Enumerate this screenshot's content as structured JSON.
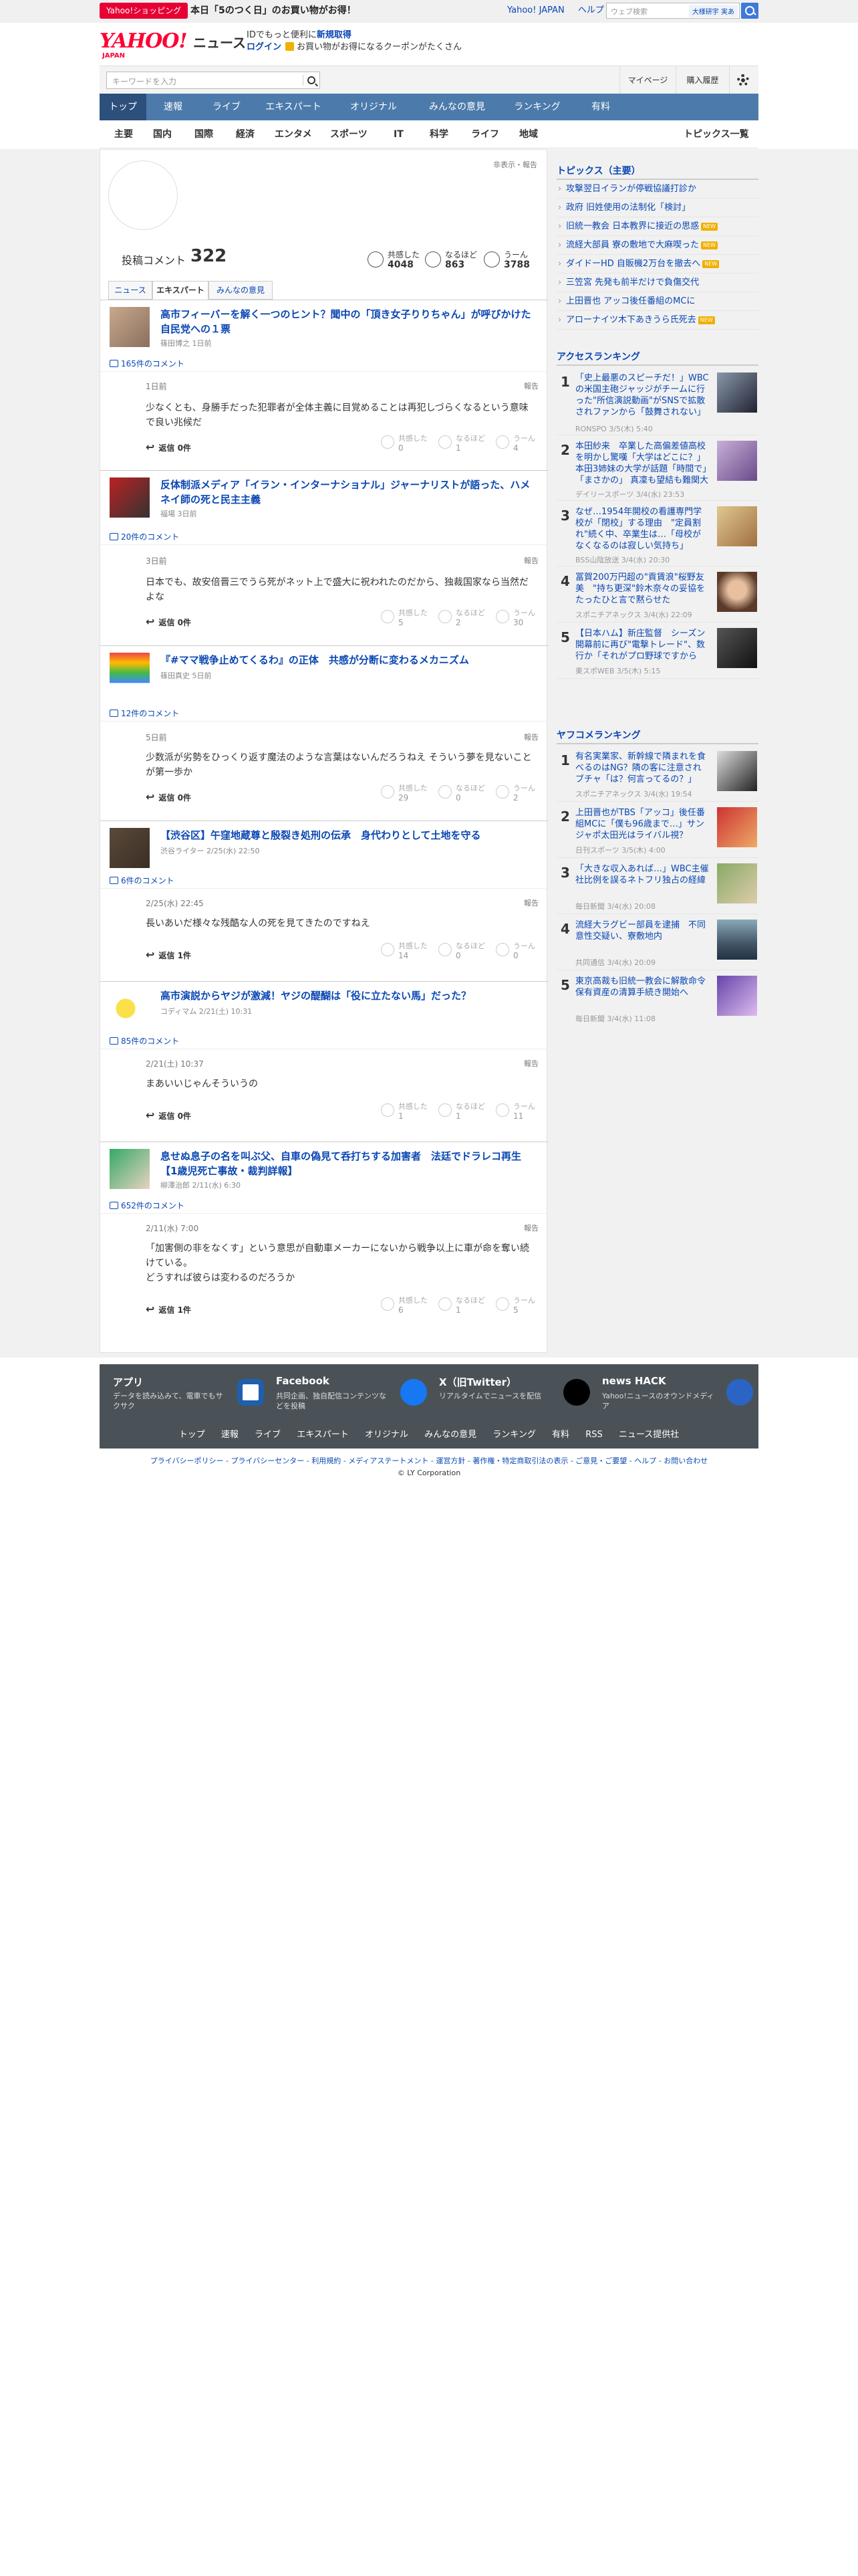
{
  "promo": {
    "badge": "Yahoo!ショッピング",
    "text": "本日「5のつく日」のお買い物がお得！",
    "link_yahoo": "Yahoo! JAPAN",
    "link_help": "ヘルプ",
    "search_placeholder": "ウェブ検索",
    "search_location": "大様研宇 実あ"
  },
  "header": {
    "logo": "YAHOO!",
    "logo_sub": "JAPAN",
    "section": "ニュース",
    "login_line1_prefix": "IDでもっと便利に",
    "login_line1_link": "新規取得",
    "login_link": "ログイン",
    "login_line2": "お買い物がお得になるクーポンがたくさん"
  },
  "search": {
    "placeholder": "キーワードを入力",
    "mypage": "マイページ",
    "history": "購入履歴"
  },
  "nav": {
    "items": [
      "トップ",
      "速報",
      "ライブ",
      "エキスパート",
      "オリジナル",
      "みんなの意見",
      "ランキング",
      "有料"
    ]
  },
  "subnav": {
    "items": [
      "主要",
      "国内",
      "国際",
      "経済",
      "エンタメ",
      "スポーツ",
      "IT",
      "科学",
      "ライフ",
      "地域"
    ],
    "all_topics": "トピックス一覧"
  },
  "profile": {
    "report_link": "非表示・報告",
    "count_label": "投稿コメント",
    "count": "322",
    "reactions": [
      {
        "label": "共感した",
        "value": "4048"
      },
      {
        "label": "なるほど",
        "value": "863"
      },
      {
        "label": "うーん",
        "value": "3788"
      }
    ],
    "tabs": [
      "ニュース",
      "エキスパート",
      "みんなの意見"
    ]
  },
  "entries": [
    {
      "title": "高市フィーバーを解く一つのヒント？聞中の「頂き女子りりちゃん」が呼びかけた自民党への１票",
      "source": "篠田博之 1日前",
      "comments_link": "165件のコメント",
      "date": "1日前",
      "report": "報告",
      "body": "少なくとも、身勝手だった犯罪者が全体主義に目覚めることは再犯しづらくなるという意味で良い兆候だ",
      "reply": "返信 0件",
      "r": [
        "共感した",
        "なるほど",
        "うーん"
      ],
      "n": [
        "0",
        "1",
        "4"
      ]
    },
    {
      "title": "反体制派メディア「イラン・インターナショナル」ジャーナリストが語った、ハメネイ師の死と民主主義",
      "source": "福場 3日前",
      "comments_link": "20件のコメント",
      "date": "3日前",
      "report": "報告",
      "body": "日本でも、故安倍晋三でうら死がネット上で盛大に祝われたのだから、独裁国家なら当然だよな",
      "reply": "返信 0件",
      "r": [
        "共感した",
        "なるほど",
        "うーん"
      ],
      "n": [
        "5",
        "2",
        "30"
      ]
    },
    {
      "title": "『#ママ戦争止めてくるわ』の正体　共感が分断に変わるメカニズム",
      "source": "篠田真史 5日前",
      "comments_link": "12件のコメント",
      "date": "5日前",
      "report": "報告",
      "body": "少数派が劣勢をひっくり返す魔法のような言葉はないんだろうねえ そういう夢を見ないことが第一歩か",
      "reply": "返信 0件",
      "r": [
        "共感した",
        "なるほど",
        "うーん"
      ],
      "n": [
        "29",
        "0",
        "2"
      ]
    },
    {
      "title": "【渋谷区】午窪地蔵尊と殷裂き処刑の伝承　身代わりとして土地を守る",
      "source": "渋谷ライター 2/25(水) 22:50",
      "comments_link": "6件のコメント",
      "date": "2/25(水) 22:45",
      "report": "報告",
      "body": "長いあいだ様々な残酷な人の死を見てきたのですねえ",
      "reply": "返信 1件",
      "r": [
        "共感した",
        "なるほど",
        "うーん"
      ],
      "n": [
        "14",
        "0",
        "0"
      ]
    },
    {
      "title": "高市演説からヤジが激減！ヤジの醍醐は「役に立たない馬」だった？",
      "source": "コディマム 2/21(土) 10:31",
      "comments_link": "85件のコメント",
      "date": "2/21(土) 10:37",
      "report": "報告",
      "body": "まあいいじゃんそういうの",
      "reply": "返信 0件",
      "r": [
        "共感した",
        "なるほど",
        "うーん"
      ],
      "n": [
        "1",
        "1",
        "11"
      ]
    },
    {
      "title": "息せぬ息子の名を叫ぶ父、自車の偽見て呑打ちする加害者　法廷でドラレコ再生【1歳児死亡事故・裁判詳報】",
      "source": "柳澤治郎 2/11(水) 6:30",
      "comments_link": "652件のコメント",
      "date": "2/11(水) 7:00",
      "report": "報告",
      "body": "「加害側の非をなくす」という意思が自動車メーカーにないから戦争以上に車が命を奪い続けている。\nどうすれば彼らは変わるのだろうか",
      "reply": "返信 1件",
      "r": [
        "共感した",
        "なるほど",
        "うーん"
      ],
      "n": [
        "6",
        "1",
        "5"
      ]
    }
  ],
  "sidebar": {
    "topics_title": "トピックス（主要）",
    "topics": [
      {
        "text": "攻撃翌日イランが停戦協議打診か",
        "new": false
      },
      {
        "text": "政府 旧姓使用の法制化「検討」",
        "new": false
      },
      {
        "text": "旧統一教会 日本教界に接近の思惑",
        "new": true
      },
      {
        "text": "流経大部員 寮の敷地で大麻喫った",
        "new": true
      },
      {
        "text": "ダイドーHD 自販機2万台を撤去へ",
        "new": true
      },
      {
        "text": "三笠宮 先発も前半だけで負傷交代",
        "new": false
      },
      {
        "text": "上田晋也 アッコ後任番組のMCに",
        "new": false
      },
      {
        "text": "アローナイツ木下あきうら氏死去",
        "new": true
      }
    ],
    "new_label": "NEW",
    "access_title": "アクセスランキング",
    "access": [
      {
        "title": "「史上最悪のスピーチだ！」WBC の米国主砲ジャッジがチームに行った\"所信演説動画\"がSNSで拡散されファンから「鼓舞されない」「大役指導の語り方がオーラある」と猛批判浴びる",
        "src": "RONSPO 3/5(木) 5:40"
      },
      {
        "title": "本田紗来　卒業した高偏差値高校を明かし驚嘆「大学はどこに？」本田3姉妹の大学が話題「時間で」「まさかの」 真凜も望結も難関大",
        "src": "デイリースポーツ 3/4(水) 23:53"
      },
      {
        "title": "なぜ…1954年開校の看護専門学校が「閉校」する理由　\"定員割れ\"続く中、卒業生は…「母校がなくなるのは寂しい気持ち」",
        "src": "BSS山陰放送 3/4(水) 20:30"
      },
      {
        "title": "冨賀200万円超の\"貢賃浪\"桜野友美　\"持ち更深\"鈴木奈々の妥協をたったひと言で黙らせた",
        "src": "スポニチアネックス 3/4(水) 22:09"
      },
      {
        "title": "【日本ハム】新庄監督　シーズン開幕前に再び\"電撃トレード\"、数行か「それがプロ野球ですからね」",
        "src": "東スポWEB 3/5(木) 5:15"
      }
    ],
    "comment_title": "ヤフコメランキング",
    "comments": [
      {
        "title": "有名実業家、新幹線で隣まれを食べるのはNG？隣の客に注意されブチャ「は？何言ってるの？」",
        "src": "スポニチアネックス 3/4(水) 19:54"
      },
      {
        "title": "上田晋也がTBS「アッコ」後任番組MCに「僕も96歳まで…」サンジャポ太田光はライバル視？",
        "src": "日刊スポーツ 3/5(木) 4:00"
      },
      {
        "title": "「大きな収入あれば…」WBC主催社比例を誤るネトフリ独占の経緯",
        "src": "毎日新聞 3/4(水) 20:08"
      },
      {
        "title": "流経大ラグビー部員を逮捕　不同意性交疑い、寮敷地内",
        "src": "共同通信 3/4(水) 20:09"
      },
      {
        "title": "東京高裁も旧統一教会に解散命令 保有資産の清算手続き開始へ",
        "src": "毎日新聞 3/4(水) 11:08"
      }
    ]
  },
  "footer": {
    "boxes": [
      {
        "title": "アプリ",
        "desc": "データを読み込みて、電車でもサクサク"
      },
      {
        "title": "Facebook",
        "desc": "共同企画、独自配信コンテンツなどを投稿"
      },
      {
        "title": "X（旧Twitter）",
        "desc": "リアルタイムでニュースを配信"
      },
      {
        "title": "news HACK",
        "desc": "Yahoo!ニュースのオウンドメディア"
      }
    ],
    "links": [
      "トップ",
      "速報",
      "ライブ",
      "エキスパート",
      "オリジナル",
      "みんなの意見",
      "ランキング",
      "有料",
      "RSS",
      "ニュース提供社"
    ],
    "legal": "プライバシーポリシー - プライバシーセンター - 利用規約 - メディアステートメント - 運営方針 - 著作権・特定商取引法の表示 - ご意見・ご要望 - ヘルプ - お問い合わせ",
    "copyright": "© LY Corporation"
  },
  "colors": {
    "accent": "#4c7bab",
    "link": "#0a47b4",
    "brand": "#ff0033"
  }
}
